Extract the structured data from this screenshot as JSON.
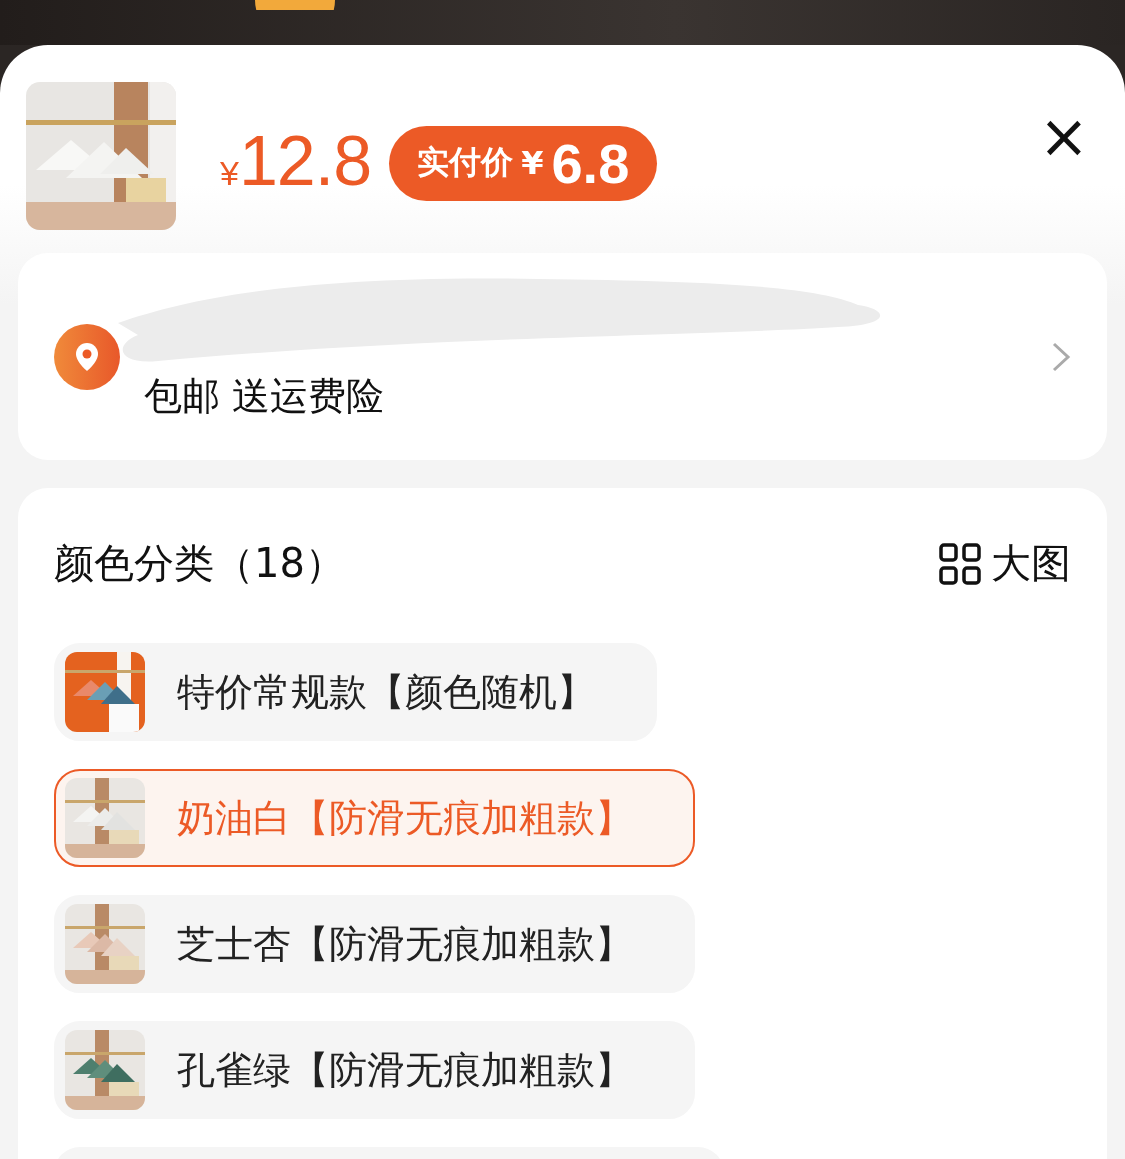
{
  "header": {
    "price": {
      "currency": "¥",
      "amount": "12.8"
    },
    "final_price": {
      "label": "实付价",
      "currency": "¥",
      "amount": "6.8"
    },
    "close": "×"
  },
  "delivery": {
    "shipping": "包邮 送运费险"
  },
  "sku": {
    "title": "颜色分类（18）",
    "view_toggle": "大图",
    "options": [
      {
        "label": "特价常规款【颜色随机】",
        "selected": false
      },
      {
        "label": "奶油白【防滑无痕加粗款】",
        "selected": true
      },
      {
        "label": "芝士杏【防滑无痕加粗款】",
        "selected": false
      },
      {
        "label": "孔雀绿【防滑无痕加粗款】",
        "selected": false
      }
    ]
  }
}
